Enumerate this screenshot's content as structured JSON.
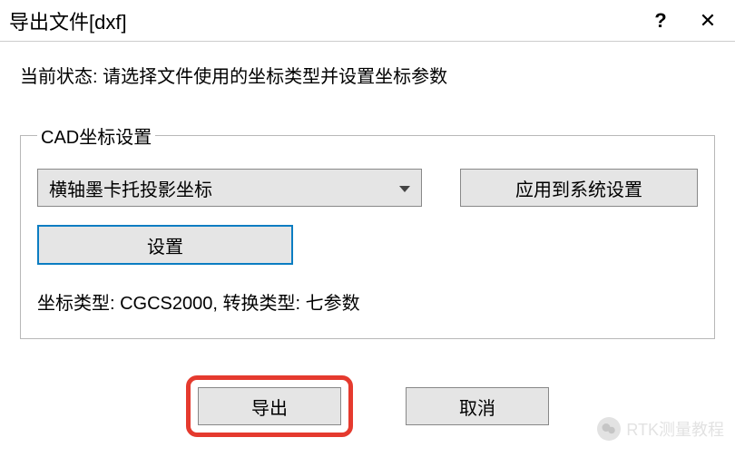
{
  "window": {
    "title": "导出文件[dxf]",
    "help": "?",
    "close": "✕"
  },
  "status": {
    "label": "当前状态:",
    "text": "请选择文件使用的坐标类型并设置坐标参数"
  },
  "coord": {
    "legend": "CAD坐标设置",
    "projection_selected": "横轴墨卡托投影坐标",
    "apply_label": "应用到系统设置",
    "settings_label": "设置",
    "info": "坐标类型: CGCS2000, 转换类型: 七参数"
  },
  "buttons": {
    "export": "导出",
    "cancel": "取消"
  },
  "watermark": {
    "text": "RTK测量教程"
  }
}
